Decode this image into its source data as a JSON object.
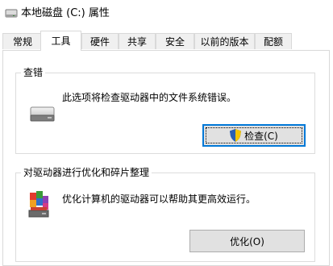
{
  "window": {
    "title": "本地磁盘 (C:) 属性"
  },
  "tabs": [
    {
      "label": "常规"
    },
    {
      "label": "工具"
    },
    {
      "label": "硬件"
    },
    {
      "label": "共享"
    },
    {
      "label": "安全"
    },
    {
      "label": "以前的版本"
    },
    {
      "label": "配额"
    }
  ],
  "active_tab": "工具",
  "error_check": {
    "title": "查错",
    "description": "此选项将检查驱动器中的文件系统错误。",
    "button_label": "检查(C)"
  },
  "optimize": {
    "title": "对驱动器进行优化和碎片整理",
    "description": "优化计算机的驱动器可以帮助其更高效运行。",
    "button_label": "优化(O)"
  },
  "colors": {
    "accent": "#0078d7",
    "tab_inactive": "#f0f0f0",
    "button_face": "#e1e1e1",
    "border": "#d9d9d9"
  }
}
